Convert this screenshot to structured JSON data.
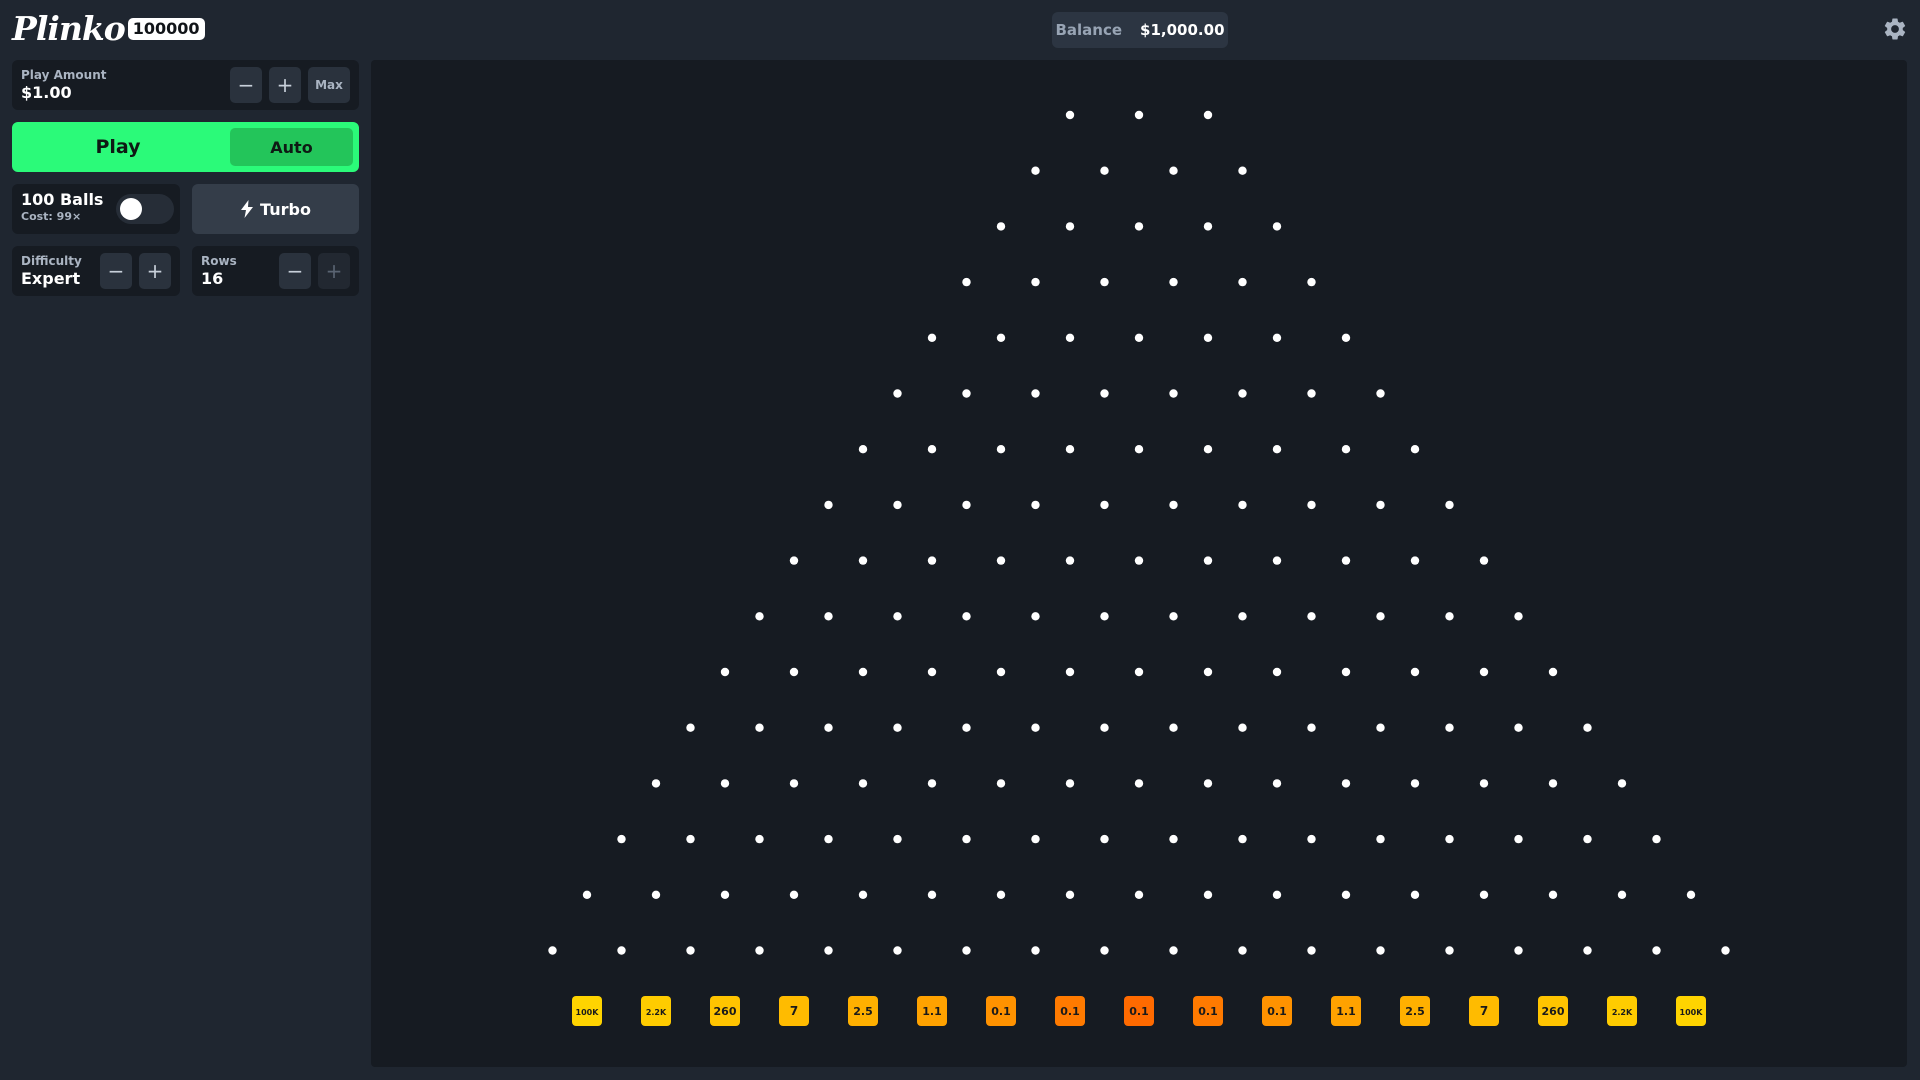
{
  "header": {
    "logo_text": "Plinko",
    "logo_badge": "100000",
    "balance_label": "Balance",
    "balance_value": "$1,000.00",
    "settings_icon": "gear-icon"
  },
  "controls": {
    "play_amount_label": "Play Amount",
    "play_amount_value": "$1.00",
    "minus": "−",
    "plus": "+",
    "max_label": "Max",
    "play_label": "Play",
    "auto_label": "Auto",
    "balls_title": "100 Balls",
    "balls_cost": "Cost: 99×",
    "balls_toggle_on": false,
    "turbo_label": "Turbo",
    "difficulty_label": "Difficulty",
    "difficulty_value": "Expert",
    "rows_label": "Rows",
    "rows_value": "16"
  },
  "board": {
    "rows": 16,
    "first_row_pegs": 3,
    "multipliers": [
      "100K",
      "2.2K",
      "260",
      "7",
      "2.5",
      "1.1",
      "0.1",
      "0.1",
      "0.1",
      "0.1",
      "0.1",
      "1.1",
      "2.5",
      "7",
      "260",
      "2.2K",
      "100K"
    ],
    "slot_colors": [
      "#ffd400",
      "#ffcc00",
      "#ffc400",
      "#ffbb00",
      "#ffb000",
      "#ffa200",
      "#ff9200",
      "#ff7a00",
      "#ff6a00",
      "#ff7a00",
      "#ff9200",
      "#ffa200",
      "#ffb000",
      "#ffbb00",
      "#ffc400",
      "#ffcc00",
      "#ffd400"
    ]
  }
}
